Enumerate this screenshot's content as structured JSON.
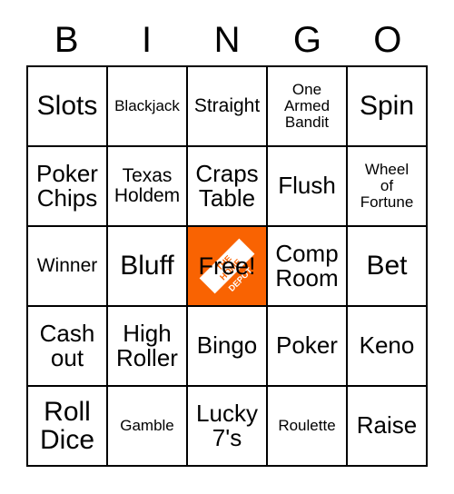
{
  "card": {
    "title": "BINGO",
    "header": [
      "B",
      "I",
      "N",
      "G",
      "O"
    ],
    "free_space": {
      "label": "Free!",
      "logo_name": "home-depot-logo",
      "logo_words": [
        "THE",
        "HOME",
        "DEPOT"
      ],
      "logo_color": "#F96302",
      "logo_text_color": "#FFFFFF"
    },
    "colors": {
      "grid_line": "#000000",
      "text": "#000000",
      "background": "#FFFFFF",
      "accent": "#F96302"
    },
    "rows": [
      [
        {
          "text": "Slots",
          "size": "xl"
        },
        {
          "text": "Blackjack",
          "size": "sm"
        },
        {
          "text": "Straight",
          "size": "md"
        },
        {
          "text": "One\nArmed\nBandit",
          "size": "sm"
        },
        {
          "text": "Spin",
          "size": "xl"
        }
      ],
      [
        {
          "text": "Poker\nChips",
          "size": "lg"
        },
        {
          "text": "Texas\nHoldem",
          "size": "md"
        },
        {
          "text": "Craps\nTable",
          "size": "lg"
        },
        {
          "text": "Flush",
          "size": "lg"
        },
        {
          "text": "Wheel\nof\nFortune",
          "size": "sm"
        }
      ],
      [
        {
          "text": "Winner",
          "size": "md"
        },
        {
          "text": "Bluff",
          "size": "xl"
        },
        {
          "text": "Free!",
          "size": "free"
        },
        {
          "text": "Comp\nRoom",
          "size": "lg"
        },
        {
          "text": "Bet",
          "size": "xl"
        }
      ],
      [
        {
          "text": "Cash\nout",
          "size": "lg"
        },
        {
          "text": "High\nRoller",
          "size": "lg"
        },
        {
          "text": "Bingo",
          "size": "lg"
        },
        {
          "text": "Poker",
          "size": "lg"
        },
        {
          "text": "Keno",
          "size": "lg"
        }
      ],
      [
        {
          "text": "Roll\nDice",
          "size": "xl"
        },
        {
          "text": "Gamble",
          "size": "sm"
        },
        {
          "text": "Lucky\n7's",
          "size": "lg"
        },
        {
          "text": "Roulette",
          "size": "sm"
        },
        {
          "text": "Raise",
          "size": "lg"
        }
      ]
    ]
  }
}
